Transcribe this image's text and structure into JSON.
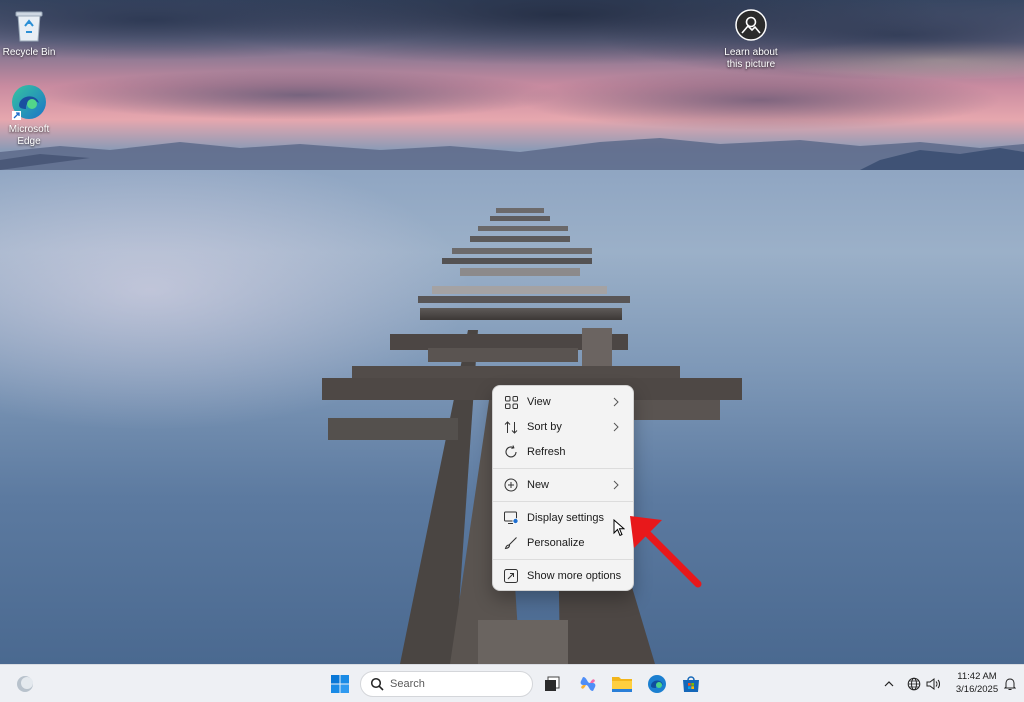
{
  "desktop": {
    "icons": [
      {
        "label": "Recycle Bin"
      },
      {
        "label": "Microsoft Edge"
      },
      {
        "label": "Learn about this picture"
      }
    ]
  },
  "context_menu": {
    "items": [
      {
        "label": "View",
        "icon": "grid-icon",
        "has_submenu": true
      },
      {
        "label": "Sort by",
        "icon": "sort-icon",
        "has_submenu": true
      },
      {
        "label": "Refresh",
        "icon": "refresh-icon",
        "has_submenu": false
      },
      {
        "label": "New",
        "icon": "plus-circle-icon",
        "has_submenu": true
      },
      {
        "label": "Display settings",
        "icon": "display-icon",
        "has_submenu": false
      },
      {
        "label": "Personalize",
        "icon": "brush-icon",
        "has_submenu": false
      },
      {
        "label": "Show more options",
        "icon": "expand-icon",
        "has_submenu": false
      }
    ]
  },
  "annotation": {
    "color": "#e8181b",
    "target": "Display settings"
  },
  "taskbar": {
    "search_placeholder": "Search",
    "time": "11:42 AM",
    "date": "3/16/2025",
    "apps": [
      "task-view",
      "copilot",
      "file-explorer",
      "edge",
      "microsoft-store"
    ]
  },
  "colors": {
    "menu_bg": "#f3f3f3",
    "taskbar_bg": "#eef0f4",
    "windows_blue": "#0078d4"
  }
}
